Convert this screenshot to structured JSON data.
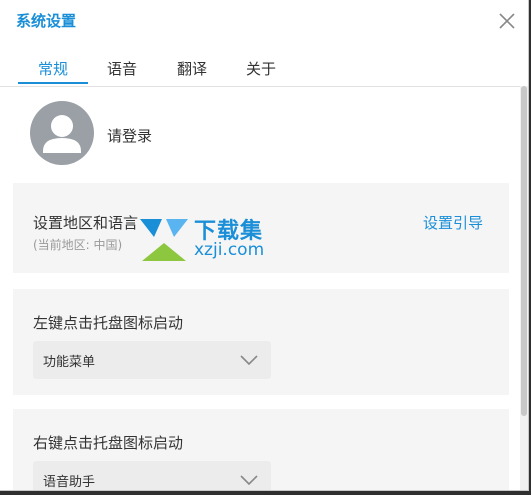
{
  "window": {
    "title": "系统设置"
  },
  "tabs": [
    {
      "label": "常规",
      "active": true
    },
    {
      "label": "语音",
      "active": false
    },
    {
      "label": "翻译",
      "active": false
    },
    {
      "label": "关于",
      "active": false
    }
  ],
  "account": {
    "login_label": "请登录",
    "avatar_icon": "user-avatar-icon"
  },
  "region": {
    "title": "设置地区和语言",
    "current": "(当前地区: 中国)",
    "guide_link": "设置引导"
  },
  "left_click": {
    "title": "左键点击托盘图标启动",
    "selected": "功能菜单"
  },
  "right_click": {
    "title": "右键点击托盘图标启动",
    "selected": "语音助手"
  },
  "watermark": {
    "cn": "下载集",
    "domain": "xzji.com"
  },
  "colors": {
    "accent": "#1a8fd8",
    "card_bg": "#f5f5f5",
    "muted": "#9a9a9a"
  }
}
